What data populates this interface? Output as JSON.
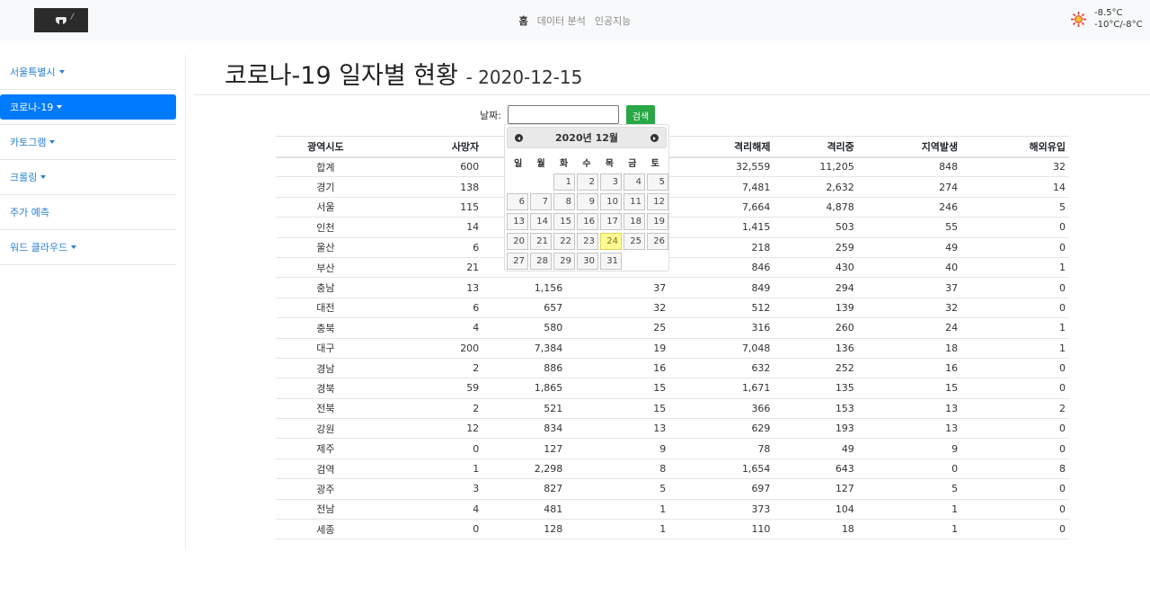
{
  "nav": {
    "items": [
      {
        "label": "홈",
        "active": true
      },
      {
        "label": "데이터 분석",
        "active": false
      },
      {
        "label": "인공지능",
        "active": false
      }
    ]
  },
  "weather": {
    "icon": "sun-icon",
    "temp": "-8.5°C",
    "range": "-10°C/-8°C"
  },
  "sidebar": {
    "items": [
      {
        "label": "서울특별시",
        "caret": true,
        "active": false
      },
      {
        "label": "코로나-19",
        "caret": true,
        "active": true
      },
      {
        "label": "카토그램",
        "caret": true,
        "active": false
      },
      {
        "label": "크롤링",
        "caret": true,
        "active": false
      },
      {
        "label": "주가 예측",
        "caret": false,
        "active": false
      },
      {
        "label": "워드 클라우드",
        "caret": true,
        "active": false
      }
    ]
  },
  "title": {
    "main": "코로나-19 일자별 현황",
    "date": "- 2020-12-15"
  },
  "search": {
    "date_label": "날짜:",
    "input_value": "",
    "button_label": "검색"
  },
  "datepicker": {
    "title": "2020년 12월",
    "weekdays": [
      "일",
      "월",
      "화",
      "수",
      "목",
      "금",
      "토"
    ],
    "leading_blanks": 2,
    "days": [
      "1",
      "2",
      "3",
      "4",
      "5",
      "6",
      "7",
      "8",
      "9",
      "10",
      "11",
      "12",
      "13",
      "14",
      "15",
      "16",
      "17",
      "18",
      "19",
      "20",
      "21",
      "22",
      "23",
      "24",
      "25",
      "26",
      "27",
      "28",
      "29",
      "30",
      "31"
    ],
    "today": "24"
  },
  "table": {
    "headers": [
      "광역시도",
      "사망자",
      "",
      "",
      "격리해제",
      "격리중",
      "지역발생",
      "해외유입"
    ],
    "rows": [
      [
        "합계",
        "600",
        "",
        "",
        "32,559",
        "11,205",
        "848",
        "32"
      ],
      [
        "경기",
        "138",
        "",
        "",
        "7,481",
        "2,632",
        "274",
        "14"
      ],
      [
        "서울",
        "115",
        "",
        "",
        "7,664",
        "4,878",
        "246",
        "5"
      ],
      [
        "인천",
        "14",
        "",
        "",
        "1,415",
        "503",
        "55",
        "0"
      ],
      [
        "울산",
        "6",
        "",
        "",
        "218",
        "259",
        "49",
        "0"
      ],
      [
        "부산",
        "21",
        "",
        "",
        "846",
        "430",
        "40",
        "1"
      ],
      [
        "충남",
        "13",
        "1,156",
        "37",
        "849",
        "294",
        "37",
        "0"
      ],
      [
        "대전",
        "6",
        "657",
        "32",
        "512",
        "139",
        "32",
        "0"
      ],
      [
        "충북",
        "4",
        "580",
        "25",
        "316",
        "260",
        "24",
        "1"
      ],
      [
        "대구",
        "200",
        "7,384",
        "19",
        "7,048",
        "136",
        "18",
        "1"
      ],
      [
        "경남",
        "2",
        "886",
        "16",
        "632",
        "252",
        "16",
        "0"
      ],
      [
        "경북",
        "59",
        "1,865",
        "15",
        "1,671",
        "135",
        "15",
        "0"
      ],
      [
        "전북",
        "2",
        "521",
        "15",
        "366",
        "153",
        "13",
        "2"
      ],
      [
        "강원",
        "12",
        "834",
        "13",
        "629",
        "193",
        "13",
        "0"
      ],
      [
        "제주",
        "0",
        "127",
        "9",
        "78",
        "49",
        "9",
        "0"
      ],
      [
        "검역",
        "1",
        "2,298",
        "8",
        "1,654",
        "643",
        "0",
        "8"
      ],
      [
        "광주",
        "3",
        "827",
        "5",
        "697",
        "127",
        "5",
        "0"
      ],
      [
        "전남",
        "4",
        "481",
        "1",
        "373",
        "104",
        "1",
        "0"
      ],
      [
        "세종",
        "0",
        "128",
        "1",
        "110",
        "18",
        "1",
        "0"
      ]
    ]
  }
}
